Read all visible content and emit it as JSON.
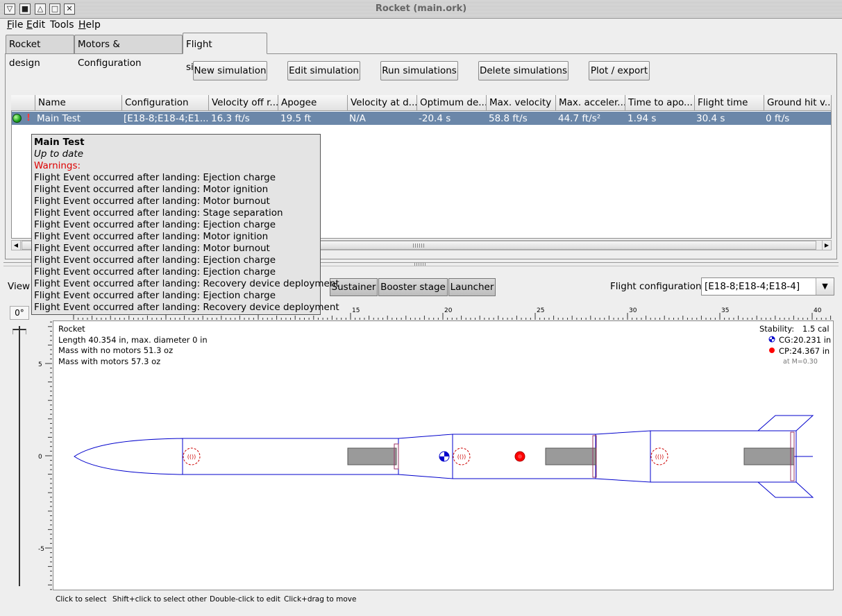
{
  "window": {
    "title": "Rocket (main.ork)"
  },
  "menu": [
    {
      "label": "File",
      "mnemonic": "F",
      "rest": "ile"
    },
    {
      "label": "Edit",
      "mnemonic": "E",
      "rest": "dit"
    },
    {
      "label": "Tools",
      "mnemonic": "",
      "rest": "Tools"
    },
    {
      "label": "Help",
      "mnemonic": "H",
      "rest": "elp"
    }
  ],
  "tabs": [
    "Rocket design",
    "Motors & Configuration",
    "Flight simulations"
  ],
  "toolbar": {
    "new": "New simulation",
    "edit": "Edit simulation",
    "run": "Run simulations",
    "delete": "Delete simulations",
    "plot": "Plot / export"
  },
  "table": {
    "columns": [
      "Name",
      "Configuration",
      "Velocity off r...",
      "Apogee",
      "Velocity at d...",
      "Optimum de...",
      "Max. velocity",
      "Max. acceler...",
      "Time to apo...",
      "Flight time",
      "Ground hit v..."
    ],
    "rows": [
      {
        "warning": "!",
        "cells": [
          "Main Test",
          "[E18-8;E18-4;E1...",
          "16.3 ft/s",
          "19.5 ft",
          "N/A",
          "-20.4 s",
          "58.8 ft/s",
          "44.7 ft/s²",
          "1.94 s",
          "30.4 s",
          "0 ft/s"
        ]
      }
    ]
  },
  "tooltip": {
    "title": "Main Test",
    "status": "Up to date",
    "warnings_label": "Warnings:",
    "lines": [
      "Flight Event occurred after landing: Ejection charge",
      "Flight Event occurred after landing: Motor ignition",
      "Flight Event occurred after landing: Motor burnout",
      "Flight Event occurred after landing: Stage separation",
      "Flight Event occurred after landing: Ejection charge",
      "Flight Event occurred after landing: Motor ignition",
      "Flight Event occurred after landing: Motor burnout",
      "Flight Event occurred after landing: Ejection charge",
      "Flight Event occurred after landing: Ejection charge",
      "Flight Event occurred after landing: Recovery device deployment",
      "Flight Event occurred after landing: Ejection charge",
      "Flight Event occurred after landing: Recovery device deployment"
    ]
  },
  "view": {
    "label": "View",
    "angle": "0°",
    "stages": [
      "Sustainer",
      "Booster stage",
      "Launcher"
    ],
    "flight_config_label": "Flight configuration:",
    "flight_config_value": "[E18-8;E18-4;E18-4]"
  },
  "ruler": {
    "h_labels": [
      "15",
      "20",
      "25",
      "30",
      "35",
      "40"
    ],
    "v_labels": [
      "5",
      "0",
      "-5"
    ]
  },
  "rocket_info": {
    "name": "Rocket",
    "length": "Length 40.354 in, max. diameter 0 in",
    "mass_no_motors": "Mass with no motors 51.3 oz",
    "mass_with_motors": "Mass with motors 57.3 oz",
    "stability_label": "Stability:",
    "stability_value": "1.5 cal",
    "cg": "CG:20.231 in",
    "cp": "CP:24.367 in",
    "mach": "at M=0.30"
  },
  "status_bar": {
    "select": "Click to select",
    "select_other": "Shift+click to select other",
    "edit": "Double-click to edit",
    "move": "Click+drag to move"
  },
  "colors": {
    "selection": "#6b87a9",
    "outline": "#0000cc",
    "recovery": "#cc0000",
    "motor": "#9a9a9a",
    "warning": "#dd0000"
  },
  "icons": [
    "menu-icon",
    "minimize-icon",
    "shade-icon",
    "maximize-icon",
    "close-icon",
    "status-ok-icon",
    "warning-icon",
    "dropdown-arrow-icon",
    "cg-icon",
    "cp-icon"
  ]
}
